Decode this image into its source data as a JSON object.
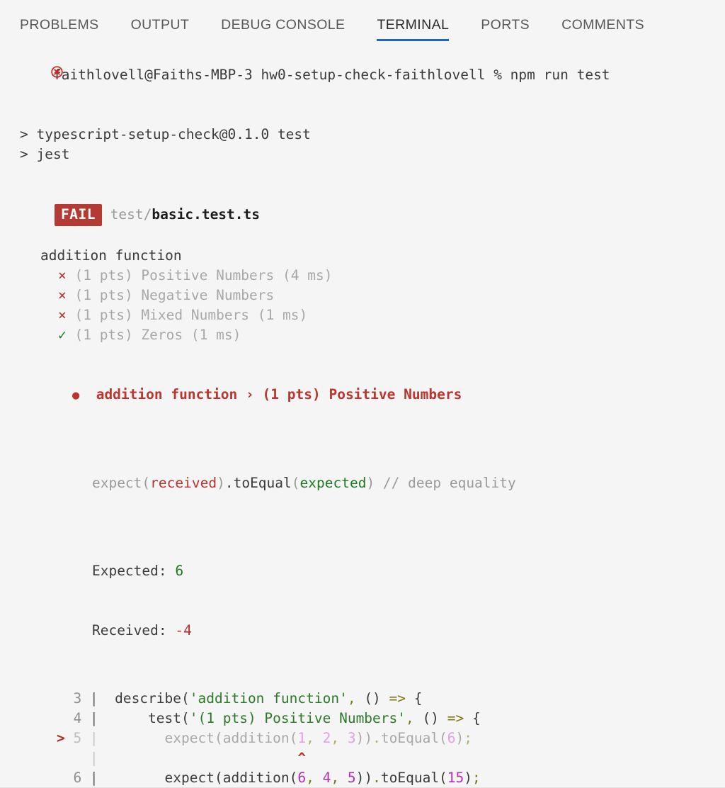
{
  "panel": {
    "tabs": [
      {
        "label": "PROBLEMS",
        "active": false
      },
      {
        "label": "OUTPUT",
        "active": false
      },
      {
        "label": "DEBUG CONSOLE",
        "active": false
      },
      {
        "label": "TERMINAL",
        "active": true
      },
      {
        "label": "PORTS",
        "active": false
      },
      {
        "label": "COMMENTS",
        "active": false
      }
    ],
    "active_tab": "TERMINAL",
    "accent_color": "#1f64c4",
    "background_color": "#f5f5f5"
  },
  "terminal": {
    "error_icon": "error-circle-x-icon",
    "prompt": {
      "user_host": "faithlovell@Faiths-MBP-3",
      "directory": "hw0-setup-check-faithlovell",
      "sigil": "%",
      "command": "npm run test",
      "full_line": "faithlovell@Faiths-MBP-3 hw0-setup-check-faithlovell % npm run test"
    },
    "npm_output": [
      "> typescript-setup-check@0.1.0 test",
      "> jest"
    ],
    "suite": {
      "status_badge": "FAIL",
      "status_badge_bg": "#b53a33",
      "path_prefix": "test/",
      "file_name": "basic.test.ts",
      "describe": "addition function",
      "tests": [
        {
          "mark": "×",
          "status": "failed",
          "label": "(1 pts) Positive Numbers",
          "duration": "(4 ms)"
        },
        {
          "mark": "×",
          "status": "failed",
          "label": "(1 pts) Negative Numbers",
          "duration": ""
        },
        {
          "mark": "×",
          "status": "failed",
          "label": "(1 pts) Mixed Numbers",
          "duration": "(1 ms)"
        },
        {
          "mark": "✓",
          "status": "passed",
          "label": "(1 pts) Zeros",
          "duration": "(1 ms)"
        }
      ]
    },
    "failure": {
      "bullet": "●",
      "describe": "addition function",
      "separator": "›",
      "test_name": "(1 pts) Positive Numbers",
      "matcher_line": {
        "expect": "expect",
        "received_arg": "received",
        "matcher": ".toEqual",
        "expected_arg": "expected",
        "comment": "// deep equality"
      },
      "expected_label": "Expected:",
      "expected_value": "6",
      "received_label": "Received:",
      "received_value": "-4"
    },
    "code_frame": {
      "lines": [
        {
          "marker": "",
          "number": "3",
          "pipe": "|",
          "dim": false,
          "tokens": [
            {
              "t": "  describe(",
              "c": "ident"
            },
            {
              "t": "'addition function'",
              "c": "string"
            },
            {
              "t": ",",
              "c": "punct"
            },
            {
              "t": " ()",
              "c": "ident"
            },
            {
              "t": " =>",
              "c": "punct"
            },
            {
              "t": " {",
              "c": "ident"
            }
          ]
        },
        {
          "marker": "",
          "number": "4",
          "pipe": "|",
          "dim": false,
          "tokens": [
            {
              "t": "      test(",
              "c": "ident"
            },
            {
              "t": "'(1 pts) Positive Numbers'",
              "c": "string"
            },
            {
              "t": ",",
              "c": "punct"
            },
            {
              "t": " ()",
              "c": "ident"
            },
            {
              "t": " =>",
              "c": "punct"
            },
            {
              "t": " {",
              "c": "ident"
            }
          ]
        },
        {
          "marker": ">",
          "number": "5",
          "pipe": "|",
          "dim": true,
          "tokens": [
            {
              "t": "        expect(addition(",
              "c": "ident"
            },
            {
              "t": "1",
              "c": "num"
            },
            {
              "t": ",",
              "c": "punct"
            },
            {
              "t": " ",
              "c": "ident"
            },
            {
              "t": "2",
              "c": "num"
            },
            {
              "t": ",",
              "c": "punct"
            },
            {
              "t": " ",
              "c": "ident"
            },
            {
              "t": "3",
              "c": "num"
            },
            {
              "t": "))",
              "c": "ident"
            },
            {
              "t": ".",
              "c": "punct"
            },
            {
              "t": "toEqual(",
              "c": "ident"
            },
            {
              "t": "6",
              "c": "num"
            },
            {
              "t": ")",
              "c": "ident"
            },
            {
              "t": ";",
              "c": "punct"
            }
          ]
        },
        {
          "marker": "",
          "number": "",
          "pipe": "|",
          "dim": true,
          "caret": "^",
          "caret_indent": 24,
          "tokens": []
        },
        {
          "marker": "",
          "number": "6",
          "pipe": "|",
          "dim": false,
          "tokens": [
            {
              "t": "        expect(addition(",
              "c": "ident"
            },
            {
              "t": "6",
              "c": "num"
            },
            {
              "t": ",",
              "c": "punct"
            },
            {
              "t": " ",
              "c": "ident"
            },
            {
              "t": "4",
              "c": "num"
            },
            {
              "t": ",",
              "c": "punct"
            },
            {
              "t": " ",
              "c": "ident"
            },
            {
              "t": "5",
              "c": "num"
            },
            {
              "t": "))",
              "c": "ident"
            },
            {
              "t": ".",
              "c": "punct"
            },
            {
              "t": "toEqual(",
              "c": "ident"
            },
            {
              "t": "15",
              "c": "num"
            },
            {
              "t": ")",
              "c": "ident"
            },
            {
              "t": ";",
              "c": "punct"
            }
          ]
        }
      ]
    }
  }
}
